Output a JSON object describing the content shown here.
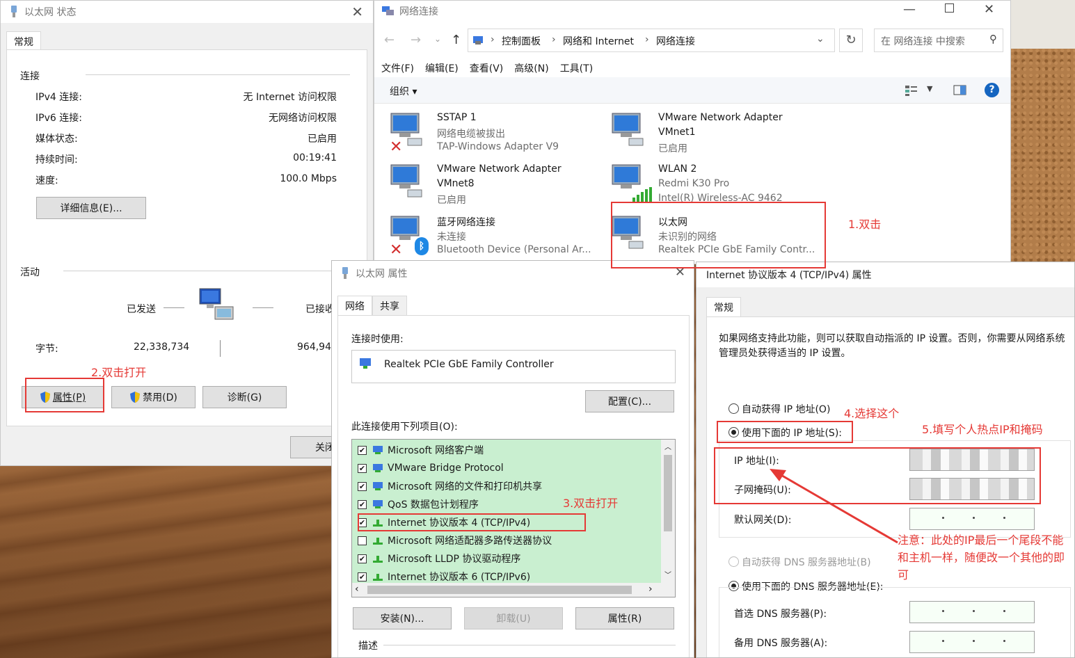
{
  "status_win": {
    "title": "以太网 状态",
    "tab": "常规",
    "connection_group": "连接",
    "rows": [
      {
        "label": "IPv4 连接:",
        "value": "无 Internet 访问权限"
      },
      {
        "label": "IPv6 连接:",
        "value": "无网络访问权限"
      },
      {
        "label": "媒体状态:",
        "value": "已启用"
      },
      {
        "label": "持续时间:",
        "value": "00:19:41"
      },
      {
        "label": "速度:",
        "value": "100.0 Mbps"
      }
    ],
    "details_button": "详细信息(E)...",
    "activity_group": "活动",
    "sent_label": "已发送",
    "received_label": "已接收",
    "bytes_label": "字节:",
    "bytes_sent": "22,338,734",
    "bytes_received": "964,94",
    "properties_button": "属性(P)",
    "disable_button": "禁用(D)",
    "diagnose_button": "诊断(G)",
    "close_button": "关闭"
  },
  "netconn_win": {
    "title": "网络连接",
    "breadcrumb": [
      "控制面板",
      "网络和 Internet",
      "网络连接"
    ],
    "search_placeholder": "在 网络连接 中搜索",
    "menu": [
      "文件(F)",
      "编辑(E)",
      "查看(V)",
      "高级(N)",
      "工具(T)"
    ],
    "organize": "组织 ▾",
    "adapters": [
      {
        "name": "SSTAP 1",
        "status": "网络电缆被拔出",
        "device": "TAP-Windows Adapter V9",
        "state": "disconnected"
      },
      {
        "name": "VMware Network Adapter",
        "status": "VMnet1",
        "device": "已启用",
        "state": "ok",
        "name_dark_line2": true
      },
      {
        "name": "VMware Network Adapter",
        "status": "VMnet8",
        "device": "已启用",
        "state": "ok",
        "name_dark_line2": true
      },
      {
        "name": "WLAN 2",
        "status": "Redmi K30 Pro",
        "device": "Intel(R) Wireless-AC 9462",
        "state": "wifi"
      },
      {
        "name": "蓝牙网络连接",
        "status": "未连接",
        "device": "Bluetooth Device (Personal Ar...",
        "state": "bluetooth"
      },
      {
        "name": "以太网",
        "status": "未识别的网络",
        "device": "Realtek PCIe GbE Family Contr...",
        "state": "ok"
      }
    ]
  },
  "props_win": {
    "title": "以太网 属性",
    "tabs": [
      "网络",
      "共享"
    ],
    "connect_using": "连接时使用:",
    "adapter": "Realtek PCIe GbE Family Controller",
    "configure_button": "配置(C)...",
    "items_label": "此连接使用下列项目(O):",
    "items": [
      {
        "label": "Microsoft 网络客户端",
        "checked": true
      },
      {
        "label": "VMware Bridge Protocol",
        "checked": true
      },
      {
        "label": "Microsoft 网络的文件和打印机共享",
        "checked": true
      },
      {
        "label": "QoS 数据包计划程序",
        "checked": true
      },
      {
        "label": "Internet 协议版本 4 (TCP/IPv4)",
        "checked": true
      },
      {
        "label": "Microsoft 网络适配器多路传送器协议",
        "checked": false
      },
      {
        "label": "Microsoft LLDP 协议驱动程序",
        "checked": true
      },
      {
        "label": "Internet 协议版本 6 (TCP/IPv6)",
        "checked": true
      }
    ],
    "install_button": "安装(N)...",
    "uninstall_button": "卸载(U)",
    "properties_button": "属性(R)",
    "description_label": "描述"
  },
  "ipv4_win": {
    "title": "Internet 协议版本 4 (TCP/IPv4) 属性",
    "tab": "常规",
    "intro": "如果网络支持此功能，则可以获取自动指派的 IP 设置。否则，你需要从网络系统管理员处获得适当的 IP 设置。",
    "auto_ip": "自动获得 IP 地址(O)",
    "manual_ip": "使用下面的 IP 地址(S):",
    "ip_label": "IP 地址(I):",
    "mask_label": "子网掩码(U):",
    "gateway_label": "默认网关(D):",
    "auto_dns": "自动获得 DNS 服务器地址(B)",
    "manual_dns": "使用下面的 DNS 服务器地址(E):",
    "dns1_label": "首选 DNS 服务器(P):",
    "dns2_label": "备用 DNS 服务器(A):"
  },
  "annotations": {
    "a1": "1.双击",
    "a2": "2.双击打开",
    "a3": "3.双击打开",
    "a4": "4.选择这个",
    "a5": "5.填写个人热点IP和掩码",
    "note": "注意：此处的IP最后一个尾段不能和主机一样，随便改一个其他的即可"
  },
  "colors": {
    "annotation": "#e53935",
    "list_bg": "#c9efd0",
    "help": "#1565c0"
  }
}
